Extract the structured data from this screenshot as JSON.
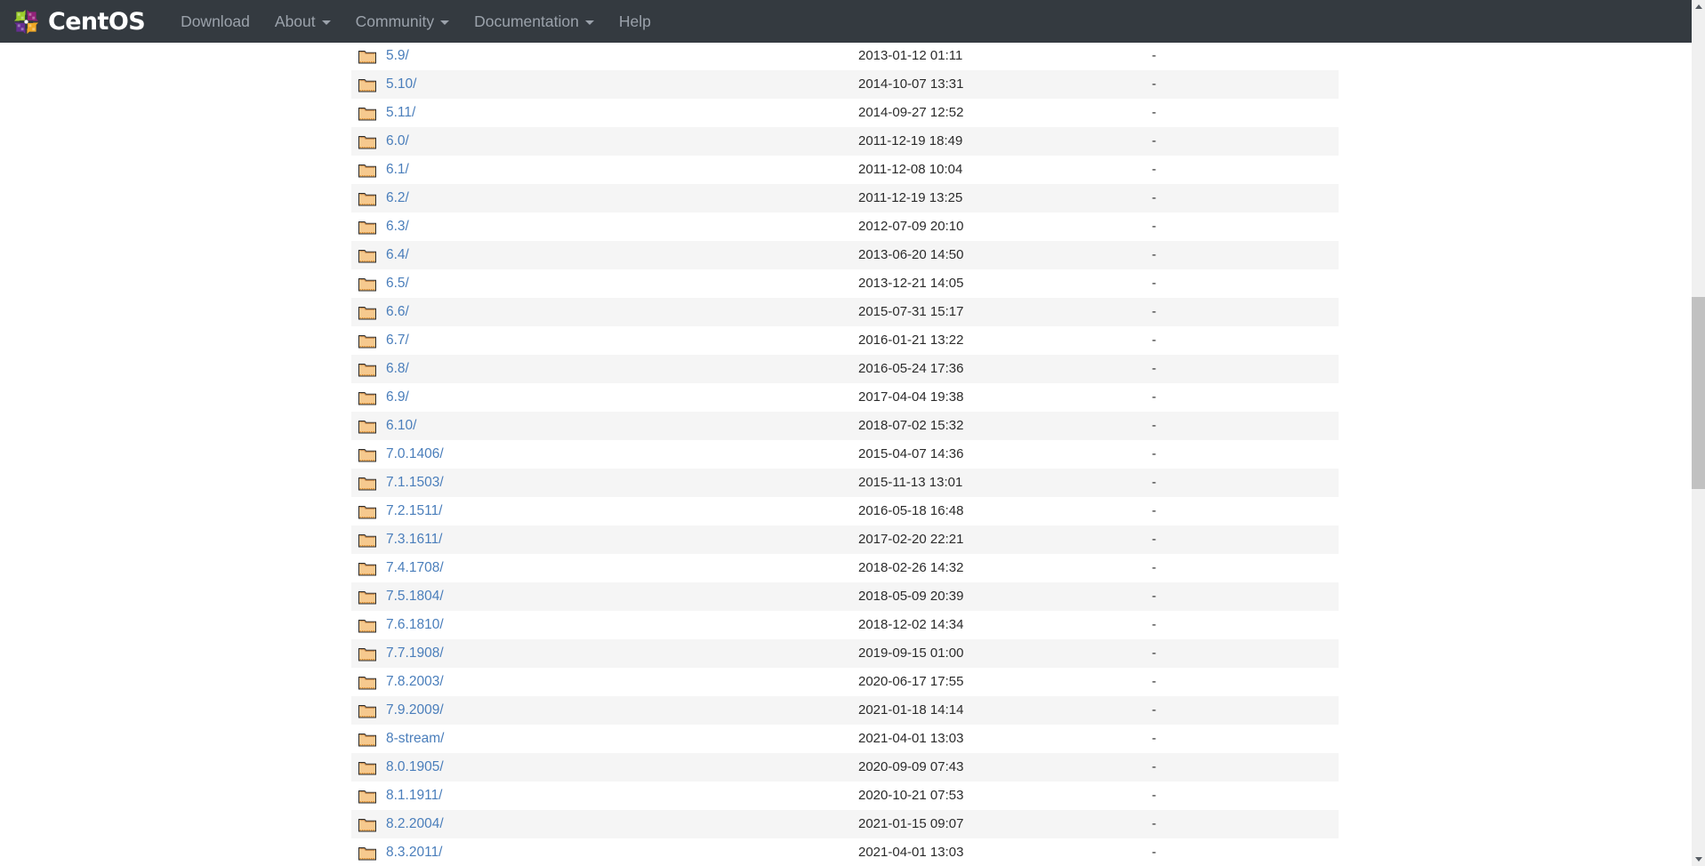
{
  "navbar": {
    "brand": {
      "name": "CentOS",
      "logo_icon": "centos-pinwheel-logo"
    },
    "background_color": "#343a40",
    "link_color": "#9ba2ab",
    "items": [
      {
        "label": "Download",
        "has_caret": false
      },
      {
        "label": "About",
        "has_caret": true
      },
      {
        "label": "Community",
        "has_caret": true
      },
      {
        "label": "Documentation",
        "has_caret": true
      },
      {
        "label": "Help",
        "has_caret": false
      }
    ]
  },
  "listing": {
    "link_color": "#4a7ebb",
    "stripe_color": "#f5f5f5",
    "folder_icon": "folder-icon",
    "rows": [
      {
        "name": "5.9/",
        "date": "2013-01-12 01:11",
        "size": "-"
      },
      {
        "name": "5.10/",
        "date": "2014-10-07 13:31",
        "size": "-"
      },
      {
        "name": "5.11/",
        "date": "2014-09-27 12:52",
        "size": "-"
      },
      {
        "name": "6.0/",
        "date": "2011-12-19 18:49",
        "size": "-"
      },
      {
        "name": "6.1/",
        "date": "2011-12-08 10:04",
        "size": "-"
      },
      {
        "name": "6.2/",
        "date": "2011-12-19 13:25",
        "size": "-"
      },
      {
        "name": "6.3/",
        "date": "2012-07-09 20:10",
        "size": "-"
      },
      {
        "name": "6.4/",
        "date": "2013-06-20 14:50",
        "size": "-"
      },
      {
        "name": "6.5/",
        "date": "2013-12-21 14:05",
        "size": "-"
      },
      {
        "name": "6.6/",
        "date": "2015-07-31 15:17",
        "size": "-"
      },
      {
        "name": "6.7/",
        "date": "2016-01-21 13:22",
        "size": "-"
      },
      {
        "name": "6.8/",
        "date": "2016-05-24 17:36",
        "size": "-"
      },
      {
        "name": "6.9/",
        "date": "2017-04-04 19:38",
        "size": "-"
      },
      {
        "name": "6.10/",
        "date": "2018-07-02 15:32",
        "size": "-"
      },
      {
        "name": "7.0.1406/",
        "date": "2015-04-07 14:36",
        "size": "-"
      },
      {
        "name": "7.1.1503/",
        "date": "2015-11-13 13:01",
        "size": "-"
      },
      {
        "name": "7.2.1511/",
        "date": "2016-05-18 16:48",
        "size": "-"
      },
      {
        "name": "7.3.1611/",
        "date": "2017-02-20 22:21",
        "size": "-"
      },
      {
        "name": "7.4.1708/",
        "date": "2018-02-26 14:32",
        "size": "-"
      },
      {
        "name": "7.5.1804/",
        "date": "2018-05-09 20:39",
        "size": "-"
      },
      {
        "name": "7.6.1810/",
        "date": "2018-12-02 14:34",
        "size": "-"
      },
      {
        "name": "7.7.1908/",
        "date": "2019-09-15 01:00",
        "size": "-"
      },
      {
        "name": "7.8.2003/",
        "date": "2020-06-17 17:55",
        "size": "-"
      },
      {
        "name": "7.9.2009/",
        "date": "2021-01-18 14:14",
        "size": "-"
      },
      {
        "name": "8-stream/",
        "date": "2021-04-01 13:03",
        "size": "-"
      },
      {
        "name": "8.0.1905/",
        "date": "2020-09-09 07:43",
        "size": "-"
      },
      {
        "name": "8.1.1911/",
        "date": "2020-10-21 07:53",
        "size": "-"
      },
      {
        "name": "8.2.2004/",
        "date": "2021-01-15 09:07",
        "size": "-"
      },
      {
        "name": "8.3.2011/",
        "date": "2021-04-01 13:03",
        "size": "-"
      }
    ]
  },
  "scrollbar": {
    "up_arrow_icon": "scroll-up-arrow-icon",
    "down_arrow_icon": "scroll-down-arrow-icon"
  }
}
